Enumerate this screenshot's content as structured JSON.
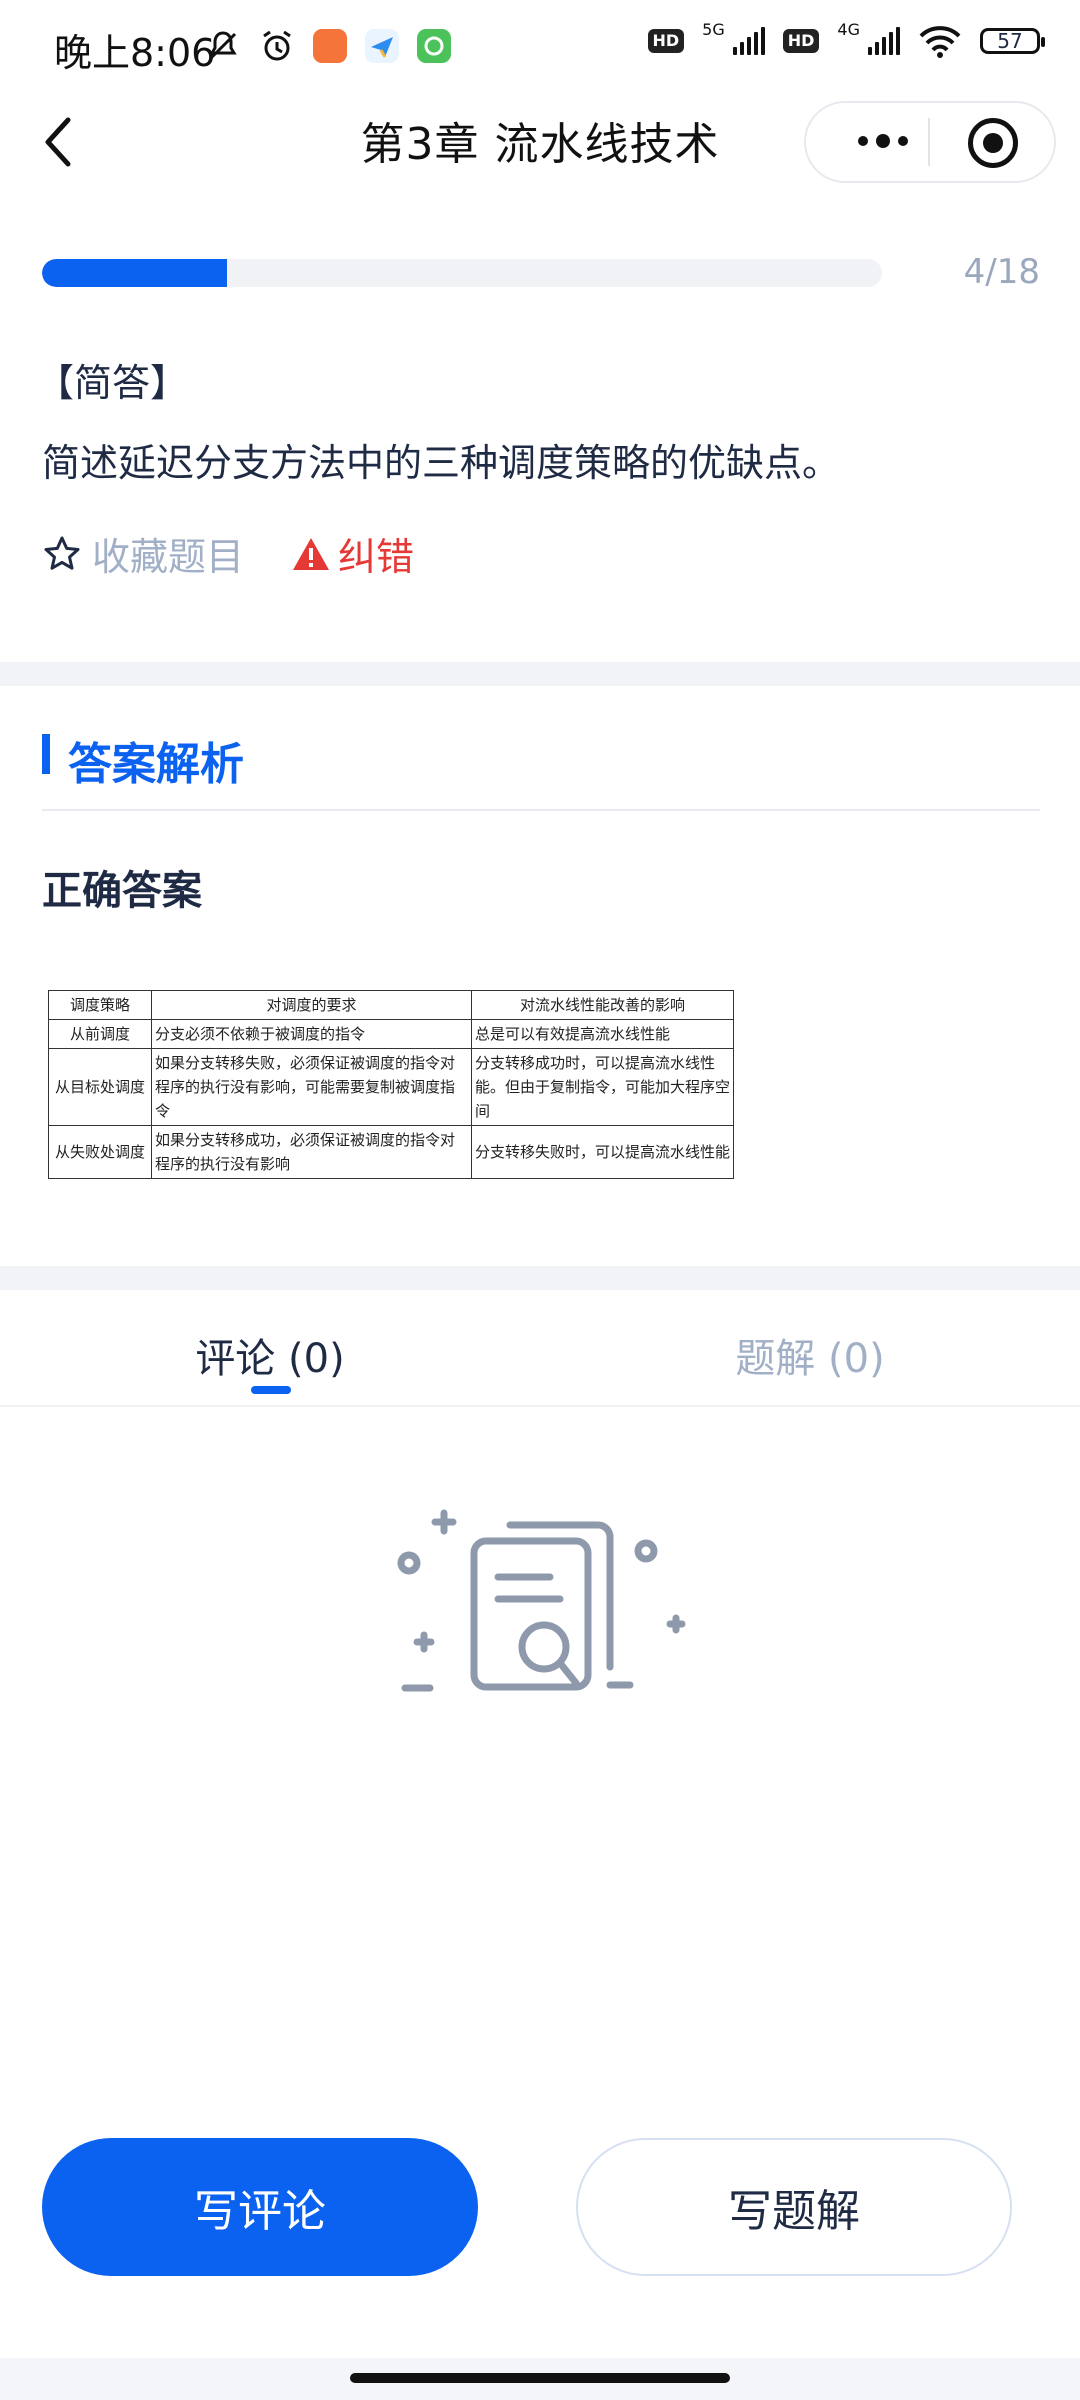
{
  "status_bar": {
    "time": "晚上8:06",
    "hd1": "HD",
    "net1": "5G",
    "hd2": "HD",
    "net2": "4G",
    "battery": "57"
  },
  "header": {
    "title": "第3章  流水线技术",
    "back_icon": "chevron-left-icon",
    "more_icon": "more-dots-icon",
    "target_icon": "target-icon"
  },
  "progress": {
    "current": 4,
    "total": 18,
    "label": "4/18",
    "fraction": 0.22
  },
  "question": {
    "type": "【简答】",
    "text": "简述延迟分支方法中的三种调度策略的优缺点。",
    "favorite_label": "收藏题目",
    "error_label": "纠错"
  },
  "answer": {
    "section_title": "答案解析",
    "correct_title": "正确答案",
    "table_headers": [
      "调度策略",
      "对调度的要求",
      "对流水线性能改善的影响"
    ],
    "table_rows": [
      [
        "从前调度",
        "分支必须不依赖于被调度的指令",
        "总是可以有效提高流水线性能"
      ],
      [
        "从目标处调度",
        "如果分支转移失败，必须保证被调度的指令对程序的执行没有影响，可能需要复制被调度指令",
        "分支转移成功时，可以提高流水线性能。但由于复制指令，可能加大程序空间"
      ],
      [
        "从失败处调度",
        "如果分支转移成功，必须保证被调度的指令对程序的执行没有影响",
        "分支转移失败时，可以提高流水线性能"
      ]
    ]
  },
  "tabs": [
    {
      "label": "评论 (0)",
      "active": true
    },
    {
      "label": "题解 (0)",
      "active": false
    }
  ],
  "empty_state": {
    "icon": "empty-search-document-icon"
  },
  "actions": {
    "comment_label": "写评论",
    "solution_label": "写题解"
  },
  "colors": {
    "accent": "#0b62f0",
    "error": "#e53935",
    "muted": "#a2b0c7"
  }
}
